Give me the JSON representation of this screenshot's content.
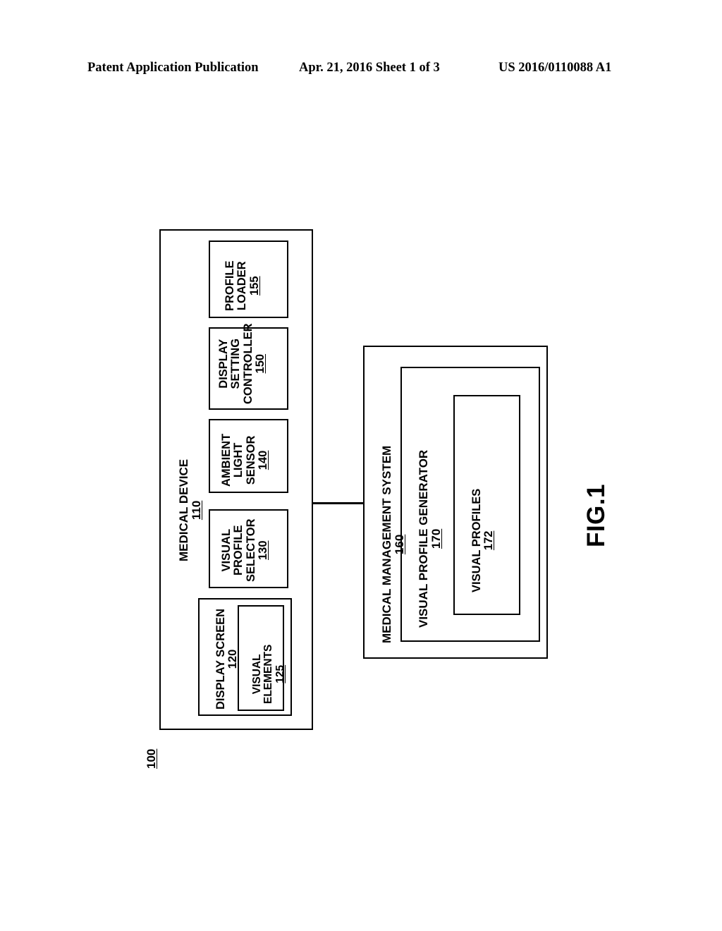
{
  "header": {
    "left": "Patent Application Publication",
    "middle": "Apr. 21, 2016  Sheet 1 of 3",
    "right": "US 2016/0110088 A1"
  },
  "figure": {
    "label": "FIG.1",
    "system_ref": "100"
  },
  "diagram": {
    "medical_device": {
      "title": "MEDICAL DEVICE",
      "ref": "110",
      "components": [
        {
          "name": "profile-loader",
          "lines": [
            "PROFILE",
            "LOADER"
          ],
          "ref": "155"
        },
        {
          "name": "display-setting-controller",
          "lines": [
            "DISPLAY",
            "SETTING",
            "CONTROLLER"
          ],
          "ref": "150"
        },
        {
          "name": "ambient-light-sensor",
          "lines": [
            "AMBIENT",
            "LIGHT",
            "SENSOR"
          ],
          "ref": "140"
        },
        {
          "name": "visual-profile-selector",
          "lines": [
            "VISUAL",
            "PROFILE",
            "SELECTOR"
          ],
          "ref": "130"
        },
        {
          "name": "display-screen",
          "lines": [
            "DISPLAY SCREEN"
          ],
          "ref": "120"
        },
        {
          "name": "visual-elements",
          "lines": [
            "VISUAL",
            "ELEMENTS"
          ],
          "ref": "125"
        }
      ]
    },
    "medical_management_system": {
      "title": "MEDICAL MANAGEMENT SYSTEM",
      "ref": "160",
      "components": [
        {
          "name": "visual-profile-generator",
          "lines": [
            "VISUAL PROFILE GENERATOR"
          ],
          "ref": "170"
        },
        {
          "name": "visual-profiles",
          "lines": [
            "VISUAL PROFILES"
          ],
          "ref": "172"
        }
      ]
    }
  },
  "colors": {
    "ink": "#000000",
    "paper": "#ffffff"
  }
}
